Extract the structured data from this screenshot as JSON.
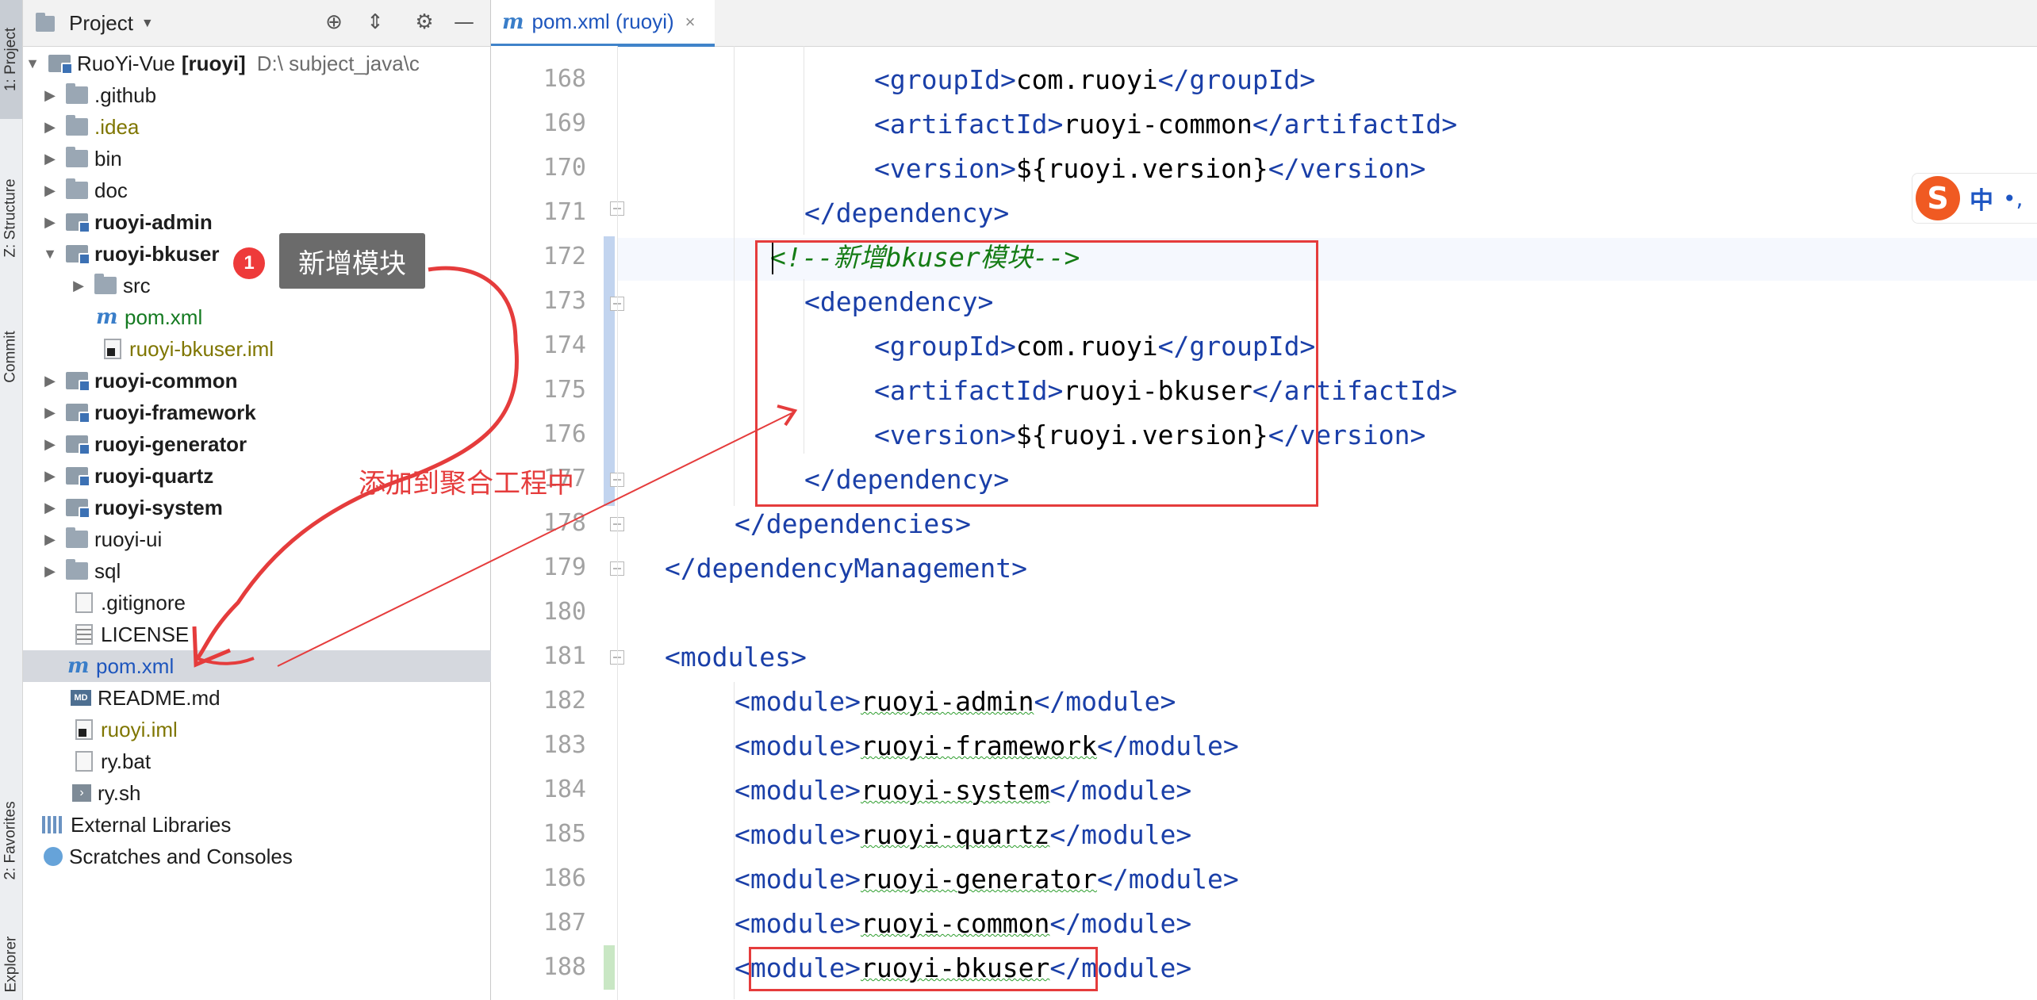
{
  "toolstrip": {
    "project": "1: Project",
    "structure": "Z: Structure",
    "commit": "Commit",
    "favorites": "2: Favorites",
    "explorer": "Explorer"
  },
  "panel": {
    "title": "Project",
    "root": {
      "name": "RuoYi-Vue",
      "module": "[ruoyi]",
      "path": "D:\\      subject_java\\c"
    },
    "items": [
      {
        "label": ".github"
      },
      {
        "label": ".idea"
      },
      {
        "label": "bin"
      },
      {
        "label": "doc"
      },
      {
        "label": "ruoyi-admin"
      },
      {
        "label": "ruoyi-bkuser"
      },
      {
        "label": "src"
      },
      {
        "label": "pom.xml"
      },
      {
        "label": "ruoyi-bkuser.iml"
      },
      {
        "label": "ruoyi-common"
      },
      {
        "label": "ruoyi-framework"
      },
      {
        "label": "ruoyi-generator"
      },
      {
        "label": "ruoyi-quartz"
      },
      {
        "label": "ruoyi-system"
      },
      {
        "label": "ruoyi-ui"
      },
      {
        "label": "sql"
      },
      {
        "label": ".gitignore"
      },
      {
        "label": "LICENSE"
      },
      {
        "label": "pom.xml"
      },
      {
        "label": "README.md"
      },
      {
        "label": "ruoyi.iml"
      },
      {
        "label": "ry.bat"
      },
      {
        "label": "ry.sh"
      },
      {
        "label": "External Libraries"
      },
      {
        "label": "Scratches and Consoles"
      }
    ]
  },
  "editor": {
    "tab": {
      "label": "pom.xml (ruoyi)",
      "icon": "m",
      "close": "×"
    },
    "line_numbers": [
      "168",
      "169",
      "170",
      "171",
      "172",
      "173",
      "174",
      "175",
      "176",
      "177",
      "178",
      "179",
      "180",
      "181",
      "182",
      "183",
      "184",
      "185",
      "186",
      "187",
      "188"
    ],
    "lines": [
      {
        "open": "groupId",
        "value": "com.ruoyi"
      },
      {
        "open": "artifactId",
        "value": "ruoyi-common"
      },
      {
        "open": "version",
        "value": "${ruoyi.version}"
      },
      {
        "close": "dependency"
      },
      {
        "comment_open": "<!--",
        "comment_text": "新增bkuser模块",
        "comment_close": "-->"
      },
      {
        "open": "dependency"
      },
      {
        "open": "groupId",
        "value": "com.ruoyi"
      },
      {
        "open": "artifactId",
        "value": "ruoyi-bkuser"
      },
      {
        "open": "version",
        "value": "${ruoyi.version}"
      },
      {
        "close": "dependency"
      },
      {
        "close": "dependencies"
      },
      {
        "close": "dependencyManagement"
      },
      {
        "blank": ""
      },
      {
        "open": "modules"
      },
      {
        "open": "module",
        "value": "ruoyi-admin"
      },
      {
        "open": "module",
        "value": "ruoyi-framework"
      },
      {
        "open": "module",
        "value": "ruoyi-system"
      },
      {
        "open": "module",
        "value": "ruoyi-quartz"
      },
      {
        "open": "module",
        "value": "ruoyi-generator"
      },
      {
        "open": "module",
        "value": "ruoyi-common"
      },
      {
        "open": "module",
        "value": "ruoyi-bkuser"
      }
    ]
  },
  "annotations": {
    "badge": "1",
    "tooltip": "新增模块",
    "note": "添加到聚合工程中"
  },
  "ime": {
    "logo": "S",
    "mode": "中",
    "punct": "•,"
  },
  "colors": {
    "accent": "#4083c9",
    "annotation_red": "#e53c3c",
    "xml_tag": "#1a3fa8",
    "comment_green": "#157c15"
  }
}
